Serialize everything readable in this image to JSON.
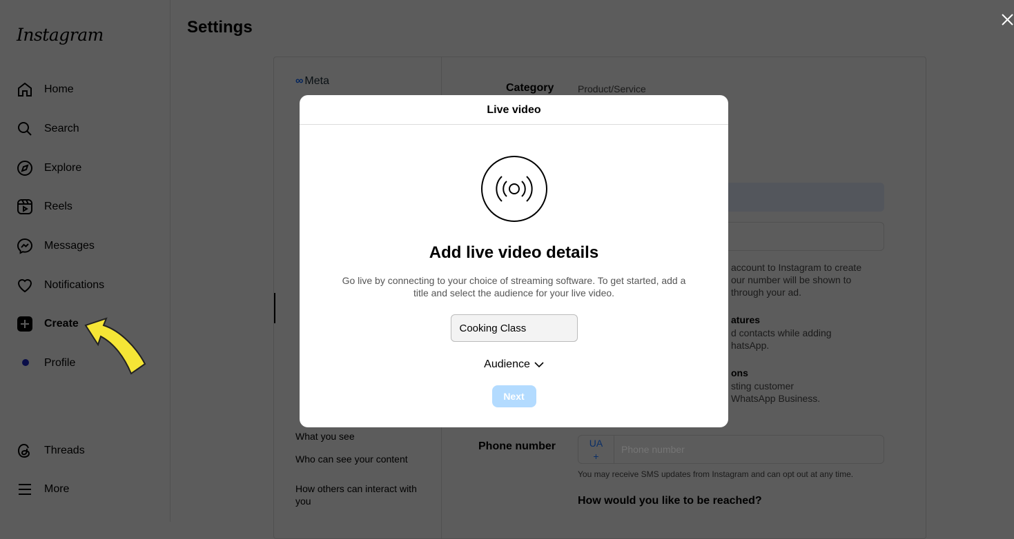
{
  "app": {
    "logo": "Instagram",
    "page_title": "Settings"
  },
  "sidebar": {
    "items": [
      {
        "label": "Home",
        "icon": "home-icon"
      },
      {
        "label": "Search",
        "icon": "search-icon"
      },
      {
        "label": "Explore",
        "icon": "compass-icon"
      },
      {
        "label": "Reels",
        "icon": "reels-icon"
      },
      {
        "label": "Messages",
        "icon": "messenger-icon"
      },
      {
        "label": "Notifications",
        "icon": "heart-icon"
      },
      {
        "label": "Create",
        "icon": "plus-square-icon",
        "active": true
      },
      {
        "label": "Profile",
        "icon": "avatar-icon"
      },
      {
        "label": "Threads",
        "icon": "threads-icon"
      },
      {
        "label": "More",
        "icon": "menu-icon"
      }
    ]
  },
  "settings_nav": {
    "brand": "Meta",
    "items": [
      "What you see",
      "Who can see your content",
      "How others can interact with you"
    ]
  },
  "settings_main": {
    "category_label": "Category",
    "category_value": "Product/Service",
    "text1": [
      "account to Instagram to create",
      "our number will be shown to",
      "through your ad."
    ],
    "heading2": "atures",
    "text2": [
      "d contacts while adding",
      "hatsApp."
    ],
    "heading3": "ons",
    "text3": [
      "sting customer",
      "WhatsApp Business."
    ],
    "phone_label": "Phone number",
    "country_code": "UA",
    "country_plus": "+",
    "phone_placeholder": "Phone number",
    "sms_note": "You may receive SMS updates from Instagram and can opt out at any time.",
    "reach_heading": "How would you like to be reached?"
  },
  "modal": {
    "title": "Live video",
    "heading": "Add live video details",
    "description": "Go live by connecting to your choice of streaming software. To get started, add a title and select the audience for your live video.",
    "title_input_value": "Cooking Class",
    "audience_label": "Audience",
    "next_label": "Next",
    "next_color": "#b3dbff"
  },
  "annotation": {
    "arrow_color": "#f5e536"
  }
}
